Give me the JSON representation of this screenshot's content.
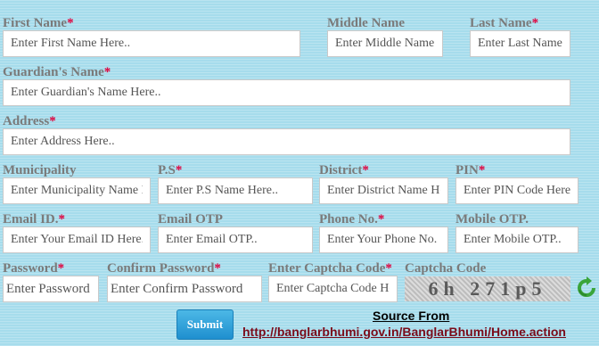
{
  "form": {
    "first_name": {
      "label": "First Name",
      "required": "*",
      "placeholder": "Enter First Name Here.."
    },
    "middle_name": {
      "label": "Middle Name",
      "placeholder": "Enter Middle Name"
    },
    "last_name": {
      "label": "Last Name",
      "required": "*",
      "placeholder": "Enter Last Name"
    },
    "guardian_name": {
      "label": "Guardian's Name",
      "required": "*",
      "placeholder": "Enter Guardian's Name Here.."
    },
    "address": {
      "label": "Address",
      "required": "*",
      "placeholder": "Enter Address Here.."
    },
    "municipality": {
      "label": "Municipality",
      "placeholder": "Enter Municipality Name Here.."
    },
    "ps": {
      "label": "P.S",
      "required": "*",
      "placeholder": "Enter P.S Name Here.."
    },
    "district": {
      "label": "District",
      "required": "*",
      "placeholder": "Enter District Name Here.."
    },
    "pin": {
      "label": "PIN",
      "required": "*",
      "placeholder": "Enter PIN Code Here.."
    },
    "email": {
      "label": "Email ID.",
      "required": "*",
      "placeholder": "Enter Your Email ID Here.."
    },
    "email_otp": {
      "label": "Email OTP",
      "placeholder": "Enter Email OTP.."
    },
    "phone": {
      "label": "Phone No.",
      "required": "*",
      "placeholder": "Enter Your Phone No. Here.."
    },
    "mobile_otp": {
      "label": "Mobile OTP.",
      "placeholder": "Enter Mobile OTP.."
    },
    "password": {
      "label": "Password",
      "required": "*",
      "placeholder": "Enter Password"
    },
    "confirm_password": {
      "label": "Confirm Password",
      "required": "*",
      "placeholder": "Enter Confirm Password"
    },
    "captcha_input": {
      "label": "Enter Captcha Code",
      "required": "*",
      "placeholder": "Enter Captcha Code Here.."
    },
    "captcha": {
      "label": "Captcha Code",
      "code": "6h 271p5"
    },
    "submit_label": "Submit"
  },
  "source": {
    "title": "Source From",
    "link": "http://banglarbhumi.gov.in/BanglarBhumi/Home.action"
  },
  "icons": {
    "refresh": "refresh-icon"
  },
  "colors": {
    "label": "#7a7a7a",
    "required": "#e0003c",
    "background": "#a6dcec",
    "link": "#7a0b1a",
    "button": "#1f8fcf"
  }
}
